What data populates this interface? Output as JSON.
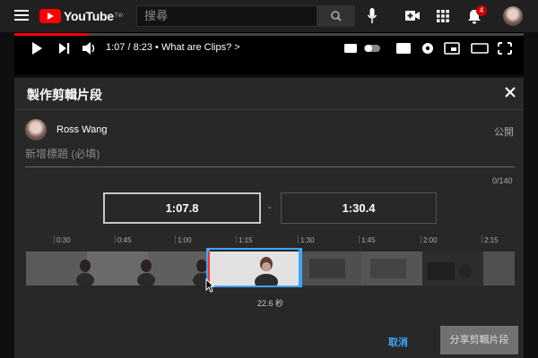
{
  "header": {
    "logo_text": "YouTube",
    "logo_suffix": "TW",
    "search_placeholder": "搜尋",
    "notification_count": "4"
  },
  "player": {
    "time": "1:07 / 8:23 • What are Clips? >",
    "progress": 0.133
  },
  "dialog": {
    "title": "製作剪輯片段",
    "channel_name": "Ross Wang",
    "visibility": "公開",
    "title_placeholder": "新增標題 (必填)",
    "char_count": "0/140",
    "start_time": "1:07.8",
    "end_time": "1:30.4",
    "dash": "-",
    "duration": "22.6 秒",
    "cancel_label": "取消",
    "share_label": "分享剪輯片段"
  },
  "timeline": {
    "ticks": [
      "0:30",
      "0:45",
      "1:00",
      "1:15",
      "1:30",
      "1:45",
      "2:00",
      "2:15"
    ]
  },
  "colors": {
    "accent": "#3ea6ff",
    "brand": "#ff0000",
    "dialog_bg": "#282828"
  }
}
